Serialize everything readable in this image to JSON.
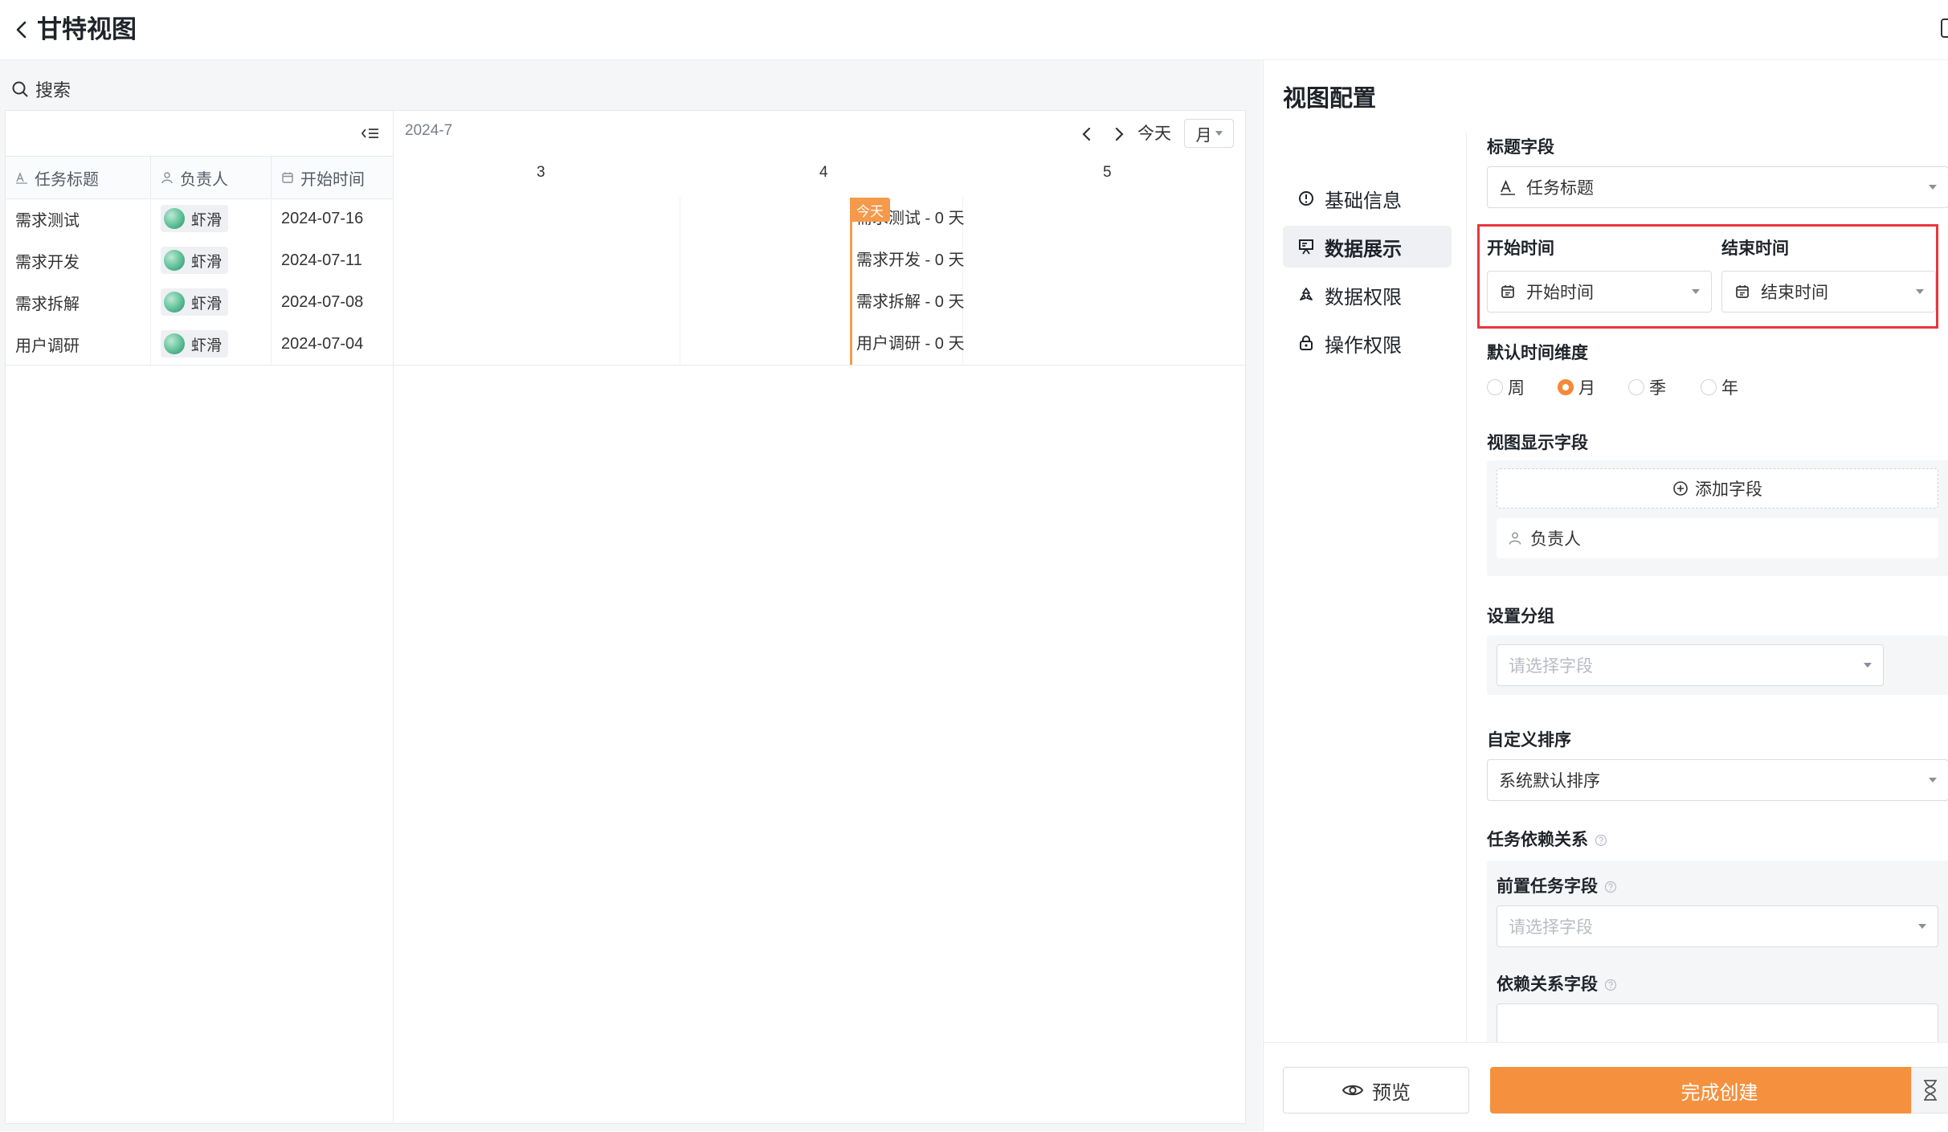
{
  "header": {
    "title": "甘特视图"
  },
  "search": {
    "label": "搜索"
  },
  "gantt": {
    "columns": [
      "任务标题",
      "负责人",
      "开始时间"
    ],
    "rows": [
      {
        "title": "需求测试",
        "owner": "虾滑",
        "start": "2024-07-16",
        "bar": "需求测试 - 0 天"
      },
      {
        "title": "需求开发",
        "owner": "虾滑",
        "start": "2024-07-11",
        "bar": "需求开发 - 0 天"
      },
      {
        "title": "需求拆解",
        "owner": "虾滑",
        "start": "2024-07-08",
        "bar": "需求拆解 - 0 天"
      },
      {
        "title": "用户调研",
        "owner": "虾滑",
        "start": "2024-07-04",
        "bar": "用户调研 - 0 天"
      }
    ],
    "month": "2024-7",
    "today_label": "今天",
    "scale": "月",
    "days": [
      "3",
      "4",
      "5"
    ],
    "today_badge": "今天",
    "accent_color": "#f59a4a"
  },
  "config": {
    "title": "视图配置",
    "nav": [
      "基础信息",
      "数据展示",
      "数据权限",
      "操作权限"
    ],
    "active_nav": "数据展示",
    "title_field_label": "标题字段",
    "title_field_value": "任务标题",
    "start_time_label": "开始时间",
    "start_time_value": "开始时间",
    "end_time_label": "结束时间",
    "end_time_value": "结束时间",
    "default_dim_label": "默认时间维度",
    "dims": [
      "周",
      "月",
      "季",
      "年"
    ],
    "selected_dim": "月",
    "display_fields_label": "视图显示字段",
    "add_field": "添加字段",
    "display_field_item": "负责人",
    "group_label": "设置分组",
    "group_placeholder": "请选择字段",
    "sort_label": "自定义排序",
    "sort_value": "系统默认排序",
    "dependency_label": "任务依赖关系",
    "pre_task_label": "前置任务字段",
    "pre_task_placeholder": "请选择字段",
    "dep_field_label": "依赖关系字段",
    "preview_btn": "预览",
    "finish_btn": "完成创建",
    "primary_color": "#f5913e",
    "highlight_color": "#e8363e"
  }
}
